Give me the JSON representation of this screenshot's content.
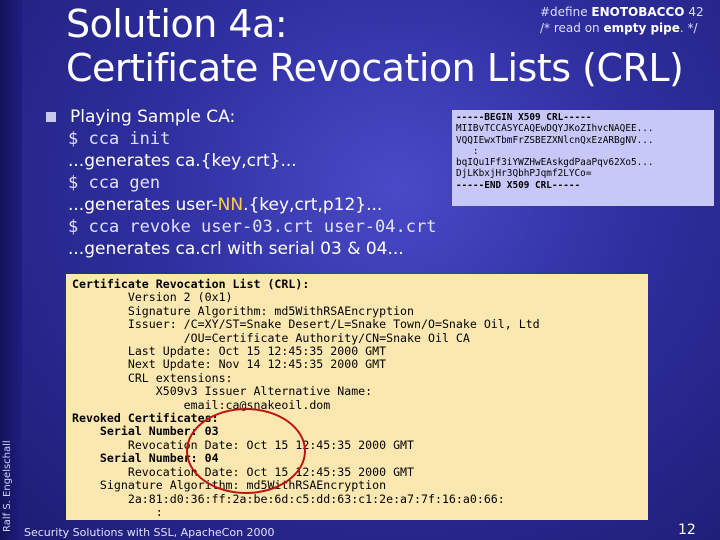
{
  "title_line1": "Solution 4a:",
  "title_line2": "Certificate Revocation Lists (CRL)",
  "quip": {
    "line1_pre": "#define ",
    "line1_bold": "ENOTOBACCO",
    "line1_post": " 42",
    "line2_pre": "/* read on ",
    "line2_bold": "empty pipe",
    "line2_post": ". */"
  },
  "crl_pem": {
    "begin": "-----BEGIN X509 CRL-----",
    "lines": [
      "MIIBvTCCASYCAQEwDQYJKoZIhvcNAQEE...",
      "VQQIEwxTbmFrZSBEZXNlcnQxEzARBgNV...",
      "   :",
      "bqIQu1Ff3iYWZHwEAskgdPaaPqv62Xo5...",
      "DjLKbxjHr3QbhPJqmf2LYCo="
    ],
    "end": "-----END X509 CRL-----"
  },
  "bullet": {
    "heading": "Playing Sample CA:",
    "cmd1": "$ cca init",
    "out1": "...generates ca.{key,crt}...",
    "cmd2": "$ cca gen",
    "out2_pre": "...generates user-",
    "out2_nn": "NN",
    "out2_post": ".{key,crt,p12}...",
    "cmd3": "$ cca revoke user-03.crt user-04.crt",
    "out3": "...generates ca.crl with serial 03 & 04..."
  },
  "cert": {
    "l1": "Certificate Revocation List (CRL):",
    "l2": "        Version 2 (0x1)",
    "l3": "        Signature Algorithm: md5WithRSAEncryption",
    "l4": "        Issuer: /C=XY/ST=Snake Desert/L=Snake Town/O=Snake Oil, Ltd",
    "l5": "                /OU=Certificate Authority/CN=Snake Oil CA",
    "l6": "        Last Update: Oct 15 12:45:35 2000 GMT",
    "l7": "        Next Update: Nov 14 12:45:35 2000 GMT",
    "l8": "        CRL extensions:",
    "l9": "            X509v3 Issuer Alternative Name:",
    "l10": "                email:ca@snakeoil.dom",
    "l11": "Revoked Certificates:",
    "l12": "    Serial Number: 03",
    "l13": "        Revocation Date: Oct 15 12:45:35 2000 GMT",
    "l14": "    Serial Number: 04",
    "l15": "        Revocation Date: Oct 15 12:45:35 2000 GMT",
    "l16": "    Signature Algorithm: md5WithRSAEncryption",
    "l17": "        2a:81:d0:36:ff:2a:be:6d:c5:dd:63:c1:2e:a7:7f:16:a0:66:",
    "l18": "            :"
  },
  "author": "Ralf S. Engelschall",
  "footer": "Security Solutions with SSL, ApacheCon 2000",
  "page_number": "12"
}
